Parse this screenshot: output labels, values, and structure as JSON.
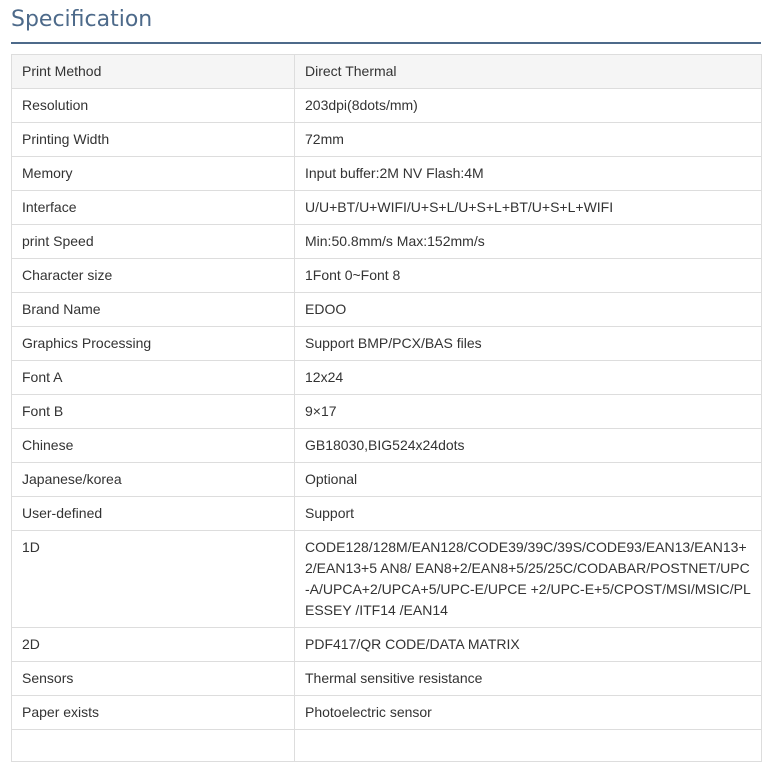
{
  "page": {
    "title": "Specification"
  },
  "spec_table": {
    "rows": [
      {
        "label": "Print Method",
        "value": "Direct Thermal"
      },
      {
        "label": "Resolution",
        "value": "203dpi(8dots/mm)"
      },
      {
        "label": "Printing Width",
        "value": "72mm"
      },
      {
        "label": "Memory",
        "value": "Input buffer:2M NV Flash:4M"
      },
      {
        "label": "Interface",
        "value": "U/U+BT/U+WIFI/U+S+L/U+S+L+BT/U+S+L+WIFI"
      },
      {
        "label": "print Speed",
        "value": "Min:50.8mm/s Max:152mm/s"
      },
      {
        "label": "Character size",
        "value": "1Font 0~Font 8"
      },
      {
        "label": "Brand Name",
        "value": "EDOO"
      },
      {
        "label": "Graphics Processing",
        "value": "Support BMP/PCX/BAS files"
      },
      {
        "label": "Font A",
        "value": "12x24"
      },
      {
        "label": "Font B",
        "value": "9×17"
      },
      {
        "label": "Chinese",
        "value": "GB18030,BIG524x24dots"
      },
      {
        "label": "Japanese/korea",
        "value": "Optional"
      },
      {
        "label": "User-defined",
        "value": "Support"
      },
      {
        "label": "1D",
        "value": "CODE128/128M/EAN128/CODE39/39C/39S/CODE93/EAN13/EAN13+2/EAN13+5 AN8/ EAN8+2/EAN8+5/25/25C/CODABAR/POSTNET/UPC-A/UPCA+2/UPCA+5/UPC-E/UPCE +2/UPC-E+5/CPOST/MSI/MSIC/PLESSEY /ITF14 /EAN14"
      },
      {
        "label": "2D",
        "value": "PDF417/QR CODE/DATA MATRIX"
      },
      {
        "label": "Sensors",
        "value": "Thermal sensitive resistance"
      },
      {
        "label": "Paper exists",
        "value": "Photoelectric sensor"
      },
      {
        "label": "",
        "value": ""
      }
    ]
  }
}
